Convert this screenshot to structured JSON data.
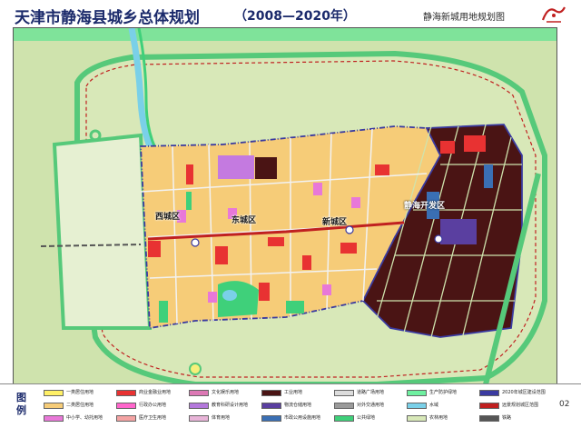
{
  "header": {
    "title": "天津市静海县城乡总体规划",
    "years": "（2008—2020年）",
    "subtitle": "静海新城用地规划图",
    "logo_icon": "city-seal-icon"
  },
  "map": {
    "district_labels": {
      "west": "西城区",
      "east": "东城区",
      "new": "新城区",
      "dev_zone": "静海开发区"
    },
    "colors": {
      "farmland": "#d8e8b8",
      "residential": "#f6cc78",
      "commercial": "#e83232",
      "industrial": "#4a1414",
      "education": "#e878d8",
      "government": "#a45fd0",
      "green": "#3fd07a",
      "water": "#7ad0e8",
      "road": "#f2f2f2",
      "planning_boundary": "#3a3aa0",
      "railway": "#c02020"
    }
  },
  "legend": {
    "title": "图例",
    "items": [
      {
        "label": "一类居住用地",
        "color": "#fff066"
      },
      {
        "label": "二类居住用地",
        "color": "#f6cc78"
      },
      {
        "label": "中小学、幼托用地",
        "color": "#e878d8"
      },
      {
        "label": "商业金融业用地",
        "color": "#e83232"
      },
      {
        "label": "行政办公用地",
        "color": "#ff66cc"
      },
      {
        "label": "医疗卫生用地",
        "color": "#f4a3a3"
      },
      {
        "label": "文化娱乐用地",
        "color": "#dc78b4"
      },
      {
        "label": "教育科研设计用地",
        "color": "#b478dc"
      },
      {
        "label": "体育用地",
        "color": "#e8b4d8"
      },
      {
        "label": "工业用地",
        "color": "#4a1414"
      },
      {
        "label": "物流仓储用地",
        "color": "#5a3fa0"
      },
      {
        "label": "市政公用设施用地",
        "color": "#3a6fb4"
      },
      {
        "label": "道路广场用地",
        "color": "#dcdcdc"
      },
      {
        "label": "对外交通用地",
        "color": "#9a9a9a"
      },
      {
        "label": "公共绿地",
        "color": "#3fd07a"
      },
      {
        "label": "生产防护绿地",
        "color": "#6ef0a0"
      },
      {
        "label": "水域",
        "color": "#7ad0e8"
      },
      {
        "label": "农林用地",
        "color": "#d8e8b8"
      },
      {
        "label": "2020年城区建设范围",
        "color": "#3a3aa0"
      },
      {
        "label": "远景规划城区范围",
        "color": "#c02020"
      },
      {
        "label": "铁路",
        "color": "#555555"
      }
    ]
  },
  "page_number": "02"
}
